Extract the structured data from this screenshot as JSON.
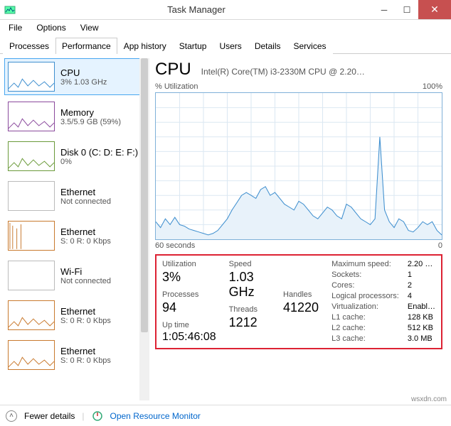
{
  "window": {
    "title": "Task Manager"
  },
  "menu": {
    "file": "File",
    "options": "Options",
    "view": "View"
  },
  "tabs": {
    "processes": "Processes",
    "performance": "Performance",
    "app_history": "App history",
    "startup": "Startup",
    "users": "Users",
    "details": "Details",
    "services": "Services"
  },
  "sidebar": [
    {
      "title": "CPU",
      "sub": "3% 1.03 GHz",
      "color": "#3f8fcf",
      "selected": true
    },
    {
      "title": "Memory",
      "sub": "3.5/5.9 GB (59%)",
      "color": "#8b4a9d"
    },
    {
      "title": "Disk 0 (C: D: E: F:)",
      "sub": "0%",
      "color": "#6b9a3a"
    },
    {
      "title": "Ethernet",
      "sub": "Not connected",
      "color": "#bbb"
    },
    {
      "title": "Ethernet",
      "sub": "S: 0 R: 0 Kbps",
      "color": "#c97a2e"
    },
    {
      "title": "Wi-Fi",
      "sub": "Not connected",
      "color": "#bbb"
    },
    {
      "title": "Ethernet",
      "sub": "S: 0 R: 0 Kbps",
      "color": "#c97a2e"
    },
    {
      "title": "Ethernet",
      "sub": "S: 0 R: 0 Kbps",
      "color": "#c97a2e"
    }
  ],
  "main": {
    "title": "CPU",
    "subtitle": "Intel(R) Core(TM) i3-2330M CPU @ 2.20…",
    "chart_top_left": "% Utilization",
    "chart_top_right": "100%",
    "chart_bottom_left": "60 seconds",
    "chart_bottom_right": "0"
  },
  "chart_data": {
    "type": "line",
    "title": "% Utilization",
    "ylabel": "% Utilization",
    "ylim": [
      0,
      100
    ],
    "x_seconds_span": 60,
    "values": [
      12,
      8,
      14,
      10,
      15,
      10,
      9,
      7,
      6,
      5,
      4,
      3,
      4,
      6,
      10,
      14,
      20,
      25,
      30,
      32,
      30,
      28,
      34,
      36,
      30,
      32,
      28,
      24,
      22,
      20,
      26,
      24,
      20,
      16,
      14,
      18,
      22,
      20,
      16,
      14,
      24,
      22,
      18,
      14,
      12,
      10,
      14,
      70,
      20,
      12,
      8,
      14,
      12,
      6,
      5,
      8,
      12,
      10,
      12,
      6,
      3
    ]
  },
  "stats": {
    "utilization_label": "Utilization",
    "utilization": "3%",
    "speed_label": "Speed",
    "speed": "1.03 GHz",
    "processes_label": "Processes",
    "processes": "94",
    "threads_label": "Threads",
    "threads": "1212",
    "handles_label": "Handles",
    "handles": "41220",
    "uptime_label": "Up time",
    "uptime": "1:05:46:08",
    "kv": {
      "max_speed_k": "Maximum speed:",
      "max_speed_v": "2.20 …",
      "sockets_k": "Sockets:",
      "sockets_v": "1",
      "cores_k": "Cores:",
      "cores_v": "2",
      "lp_k": "Logical processors:",
      "lp_v": "4",
      "virt_k": "Virtualization:",
      "virt_v": "Enabl…",
      "l1_k": "L1 cache:",
      "l1_v": "128 KB",
      "l2_k": "L2 cache:",
      "l2_v": "512 KB",
      "l3_k": "L3 cache:",
      "l3_v": "3.0 MB"
    }
  },
  "footer": {
    "fewer_details": "Fewer details",
    "open_resource_monitor": "Open Resource Monitor"
  },
  "watermark": "wsxdn.com"
}
